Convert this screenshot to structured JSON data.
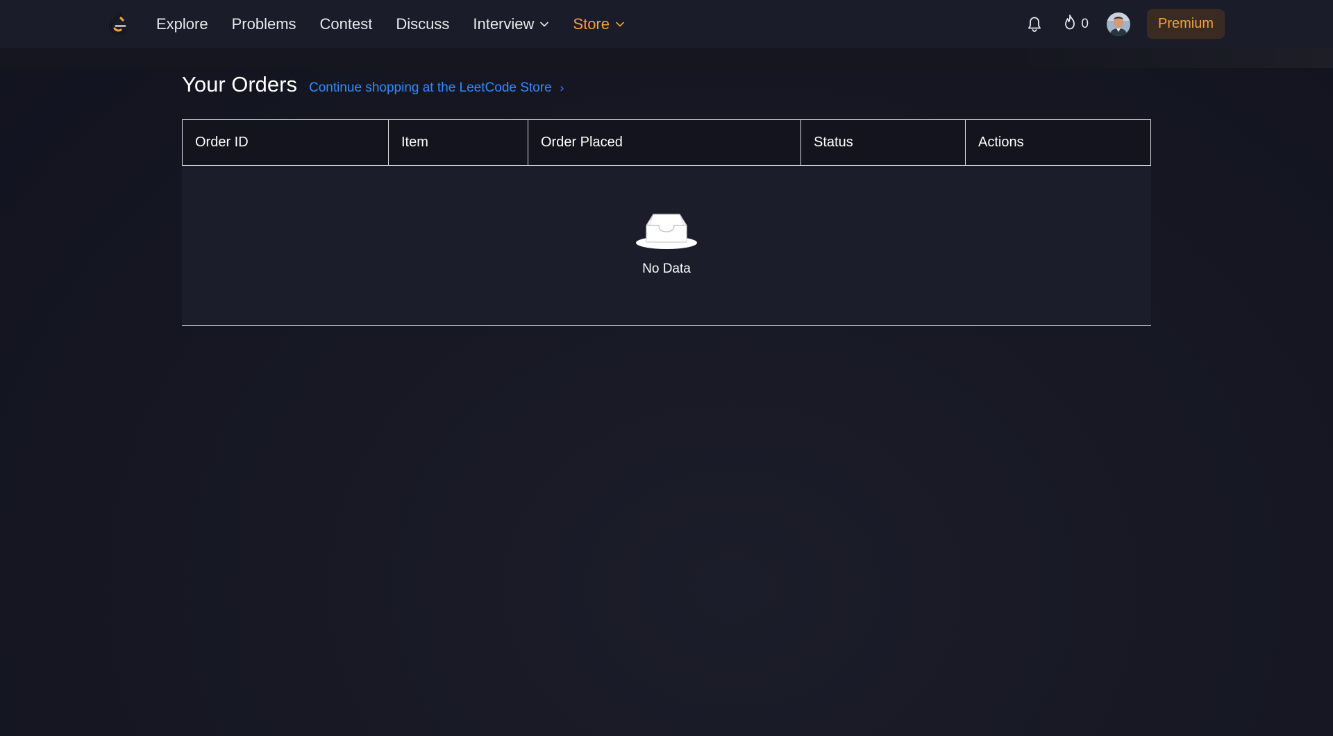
{
  "nav": {
    "items": [
      {
        "label": "Explore"
      },
      {
        "label": "Problems"
      },
      {
        "label": "Contest"
      },
      {
        "label": "Discuss"
      },
      {
        "label": "Interview"
      },
      {
        "label": "Store"
      }
    ],
    "streak_count": "0",
    "premium_label": "Premium",
    "active_color": "#f5a13a",
    "logo_icon": "leetcode-logo-icon",
    "bell_icon": "bell-icon",
    "streak_icon": "flame-icon"
  },
  "page": {
    "title": "Your Orders",
    "store_link": "Continue shopping at the LeetCode Store",
    "store_link_arrow": "›",
    "link_color": "#2f8cff"
  },
  "table": {
    "columns": [
      "Order ID",
      "Item",
      "Order Placed",
      "Status",
      "Actions"
    ],
    "rows": [],
    "empty_text": "No Data",
    "empty_icon": "empty-inbox-icon"
  }
}
